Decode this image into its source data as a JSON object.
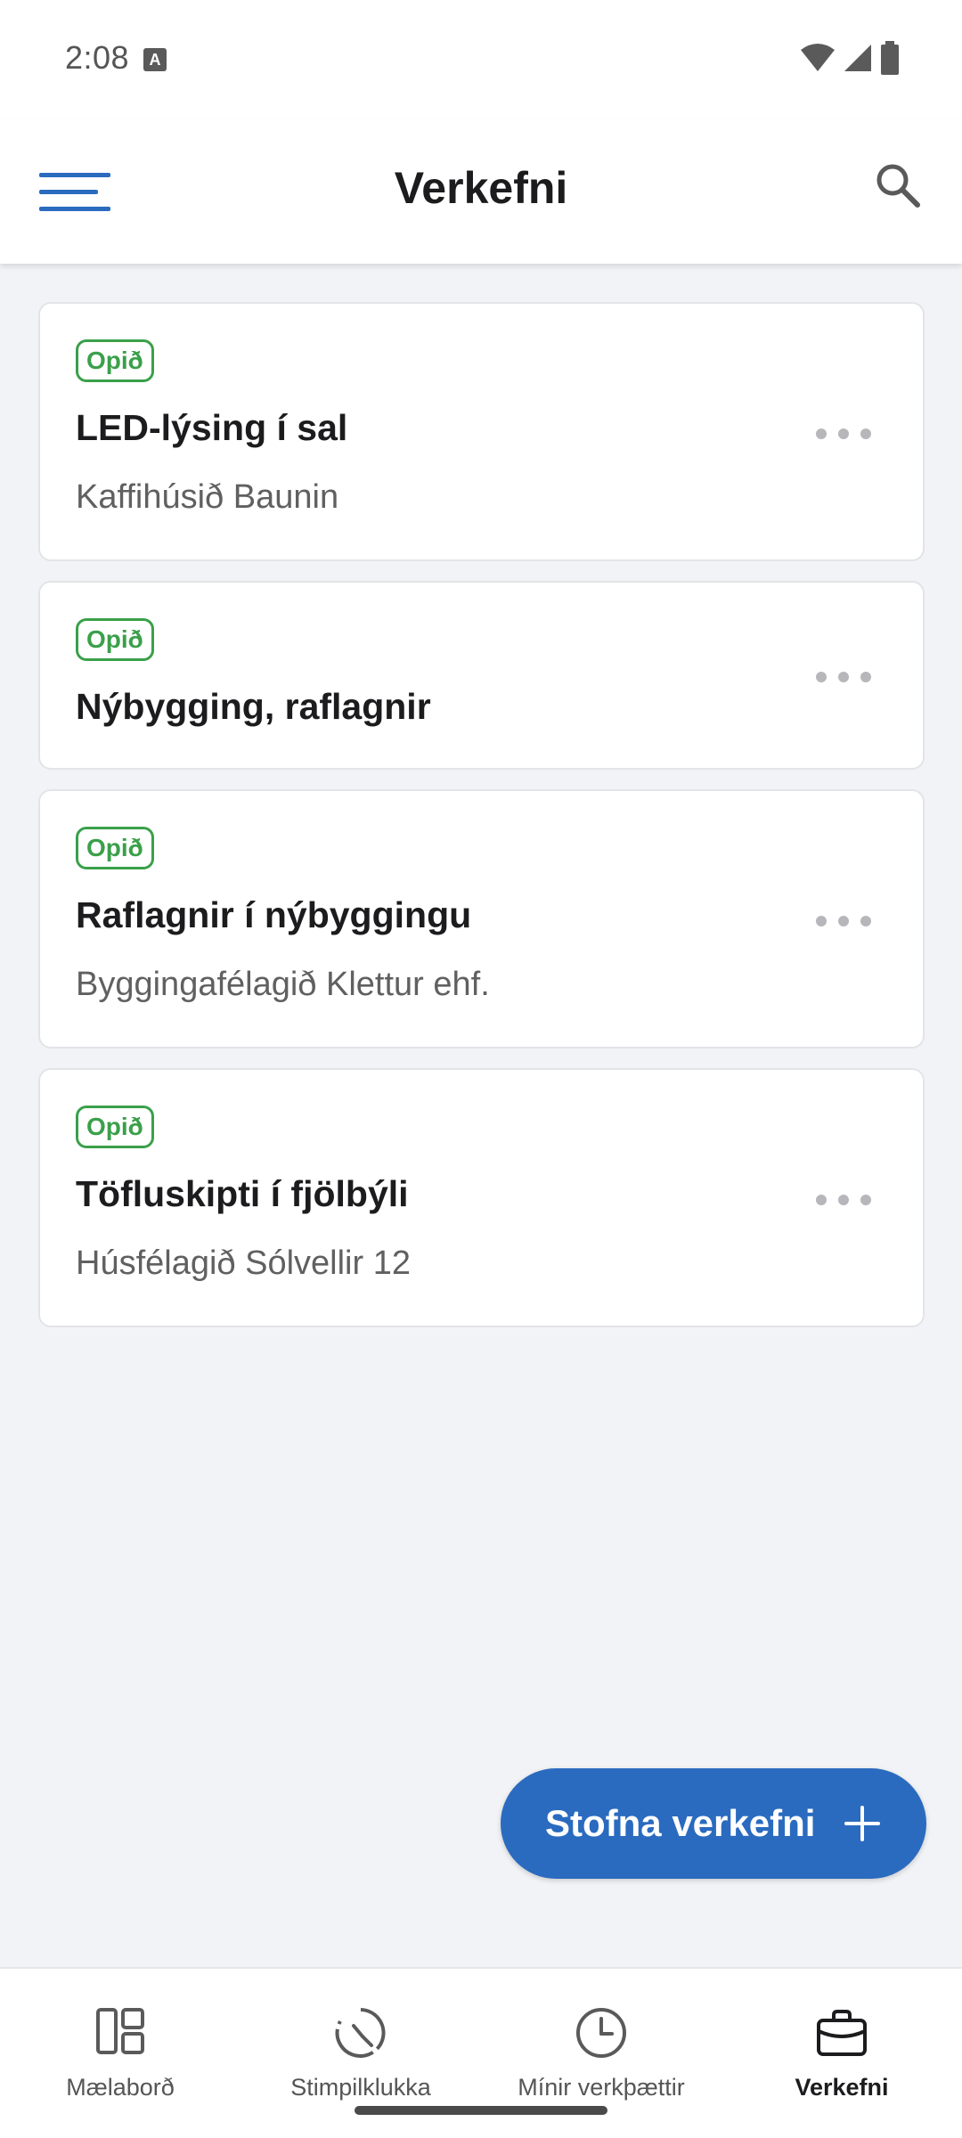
{
  "status_bar": {
    "time": "2:08"
  },
  "app_bar": {
    "title": "Verkefni"
  },
  "tasks": [
    {
      "status": "Opið",
      "title": "LED-lýsing í sal",
      "client": "Kaffihúsið Baunin"
    },
    {
      "status": "Opið",
      "title": "Nýbygging, raflagnir",
      "client": ""
    },
    {
      "status": "Opið",
      "title": "Raflagnir í nýbyggingu",
      "client": "Byggingafélagið Klettur ehf."
    },
    {
      "status": "Opið",
      "title": "Töfluskipti í fjölbýli",
      "client": "Húsfélagið Sólvellir 12"
    }
  ],
  "fab": {
    "label": "Stofna verkefni"
  },
  "bottom_nav": [
    {
      "label": "Mælaborð",
      "icon": "dashboard-icon"
    },
    {
      "label": "Stimpilklukka",
      "icon": "time-clock-icon"
    },
    {
      "label": "Mínir verkþættir",
      "icon": "clock-icon"
    },
    {
      "label": "Verkefni",
      "icon": "briefcase-icon",
      "active": true
    }
  ],
  "colors": {
    "accent": "#2a6bbf",
    "status_open": "#3aa04a"
  }
}
